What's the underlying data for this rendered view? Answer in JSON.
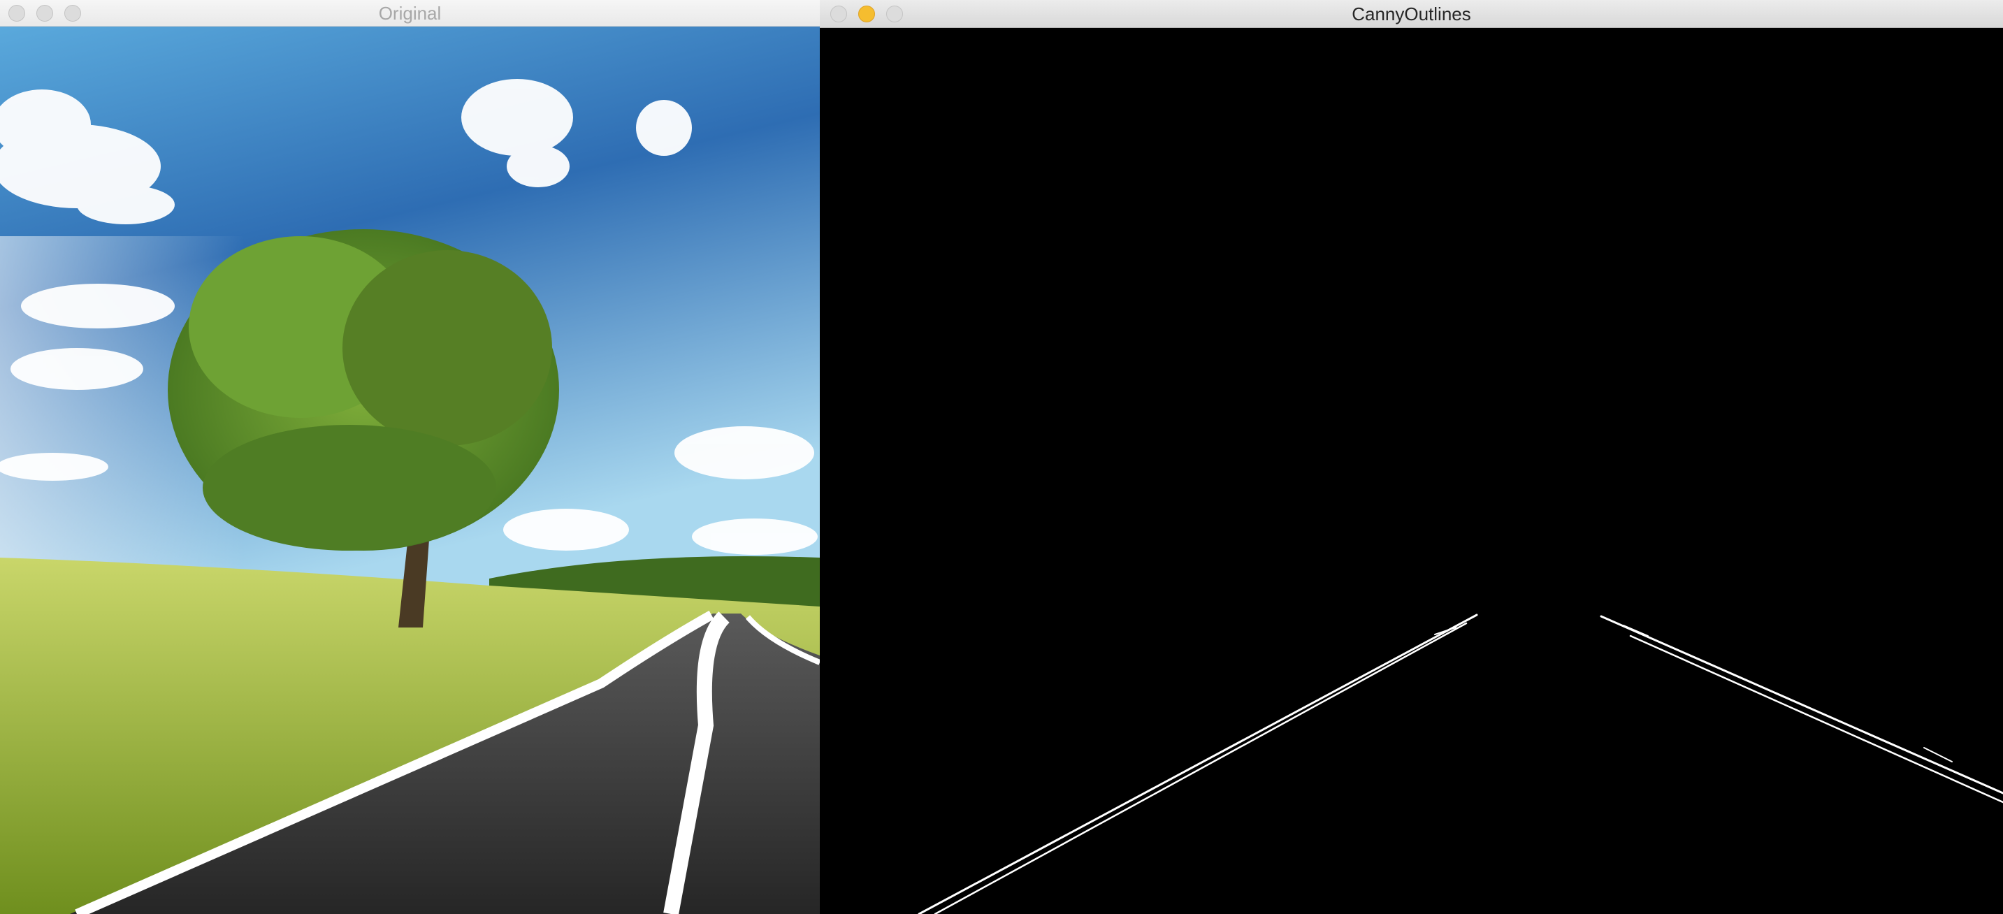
{
  "windows": {
    "original": {
      "title": "Original",
      "controls": [
        "close-button",
        "minimize-button",
        "zoom-button"
      ],
      "image_description_icon": "landscape-photo"
    },
    "canny": {
      "title": "CannyOutlines",
      "controls": [
        "close-button",
        "minimize-button",
        "zoom-button"
      ],
      "image_description_icon": "edge-map"
    }
  },
  "colors": {
    "sky_top": "#2f6fb5",
    "sky_bottom": "#9fd6f2",
    "grass": "#9cb83a",
    "road": "#2b2b2b",
    "edge_background": "#000000",
    "edge_lines": "#ffffff",
    "minimize_active": "#f5bd2f"
  }
}
